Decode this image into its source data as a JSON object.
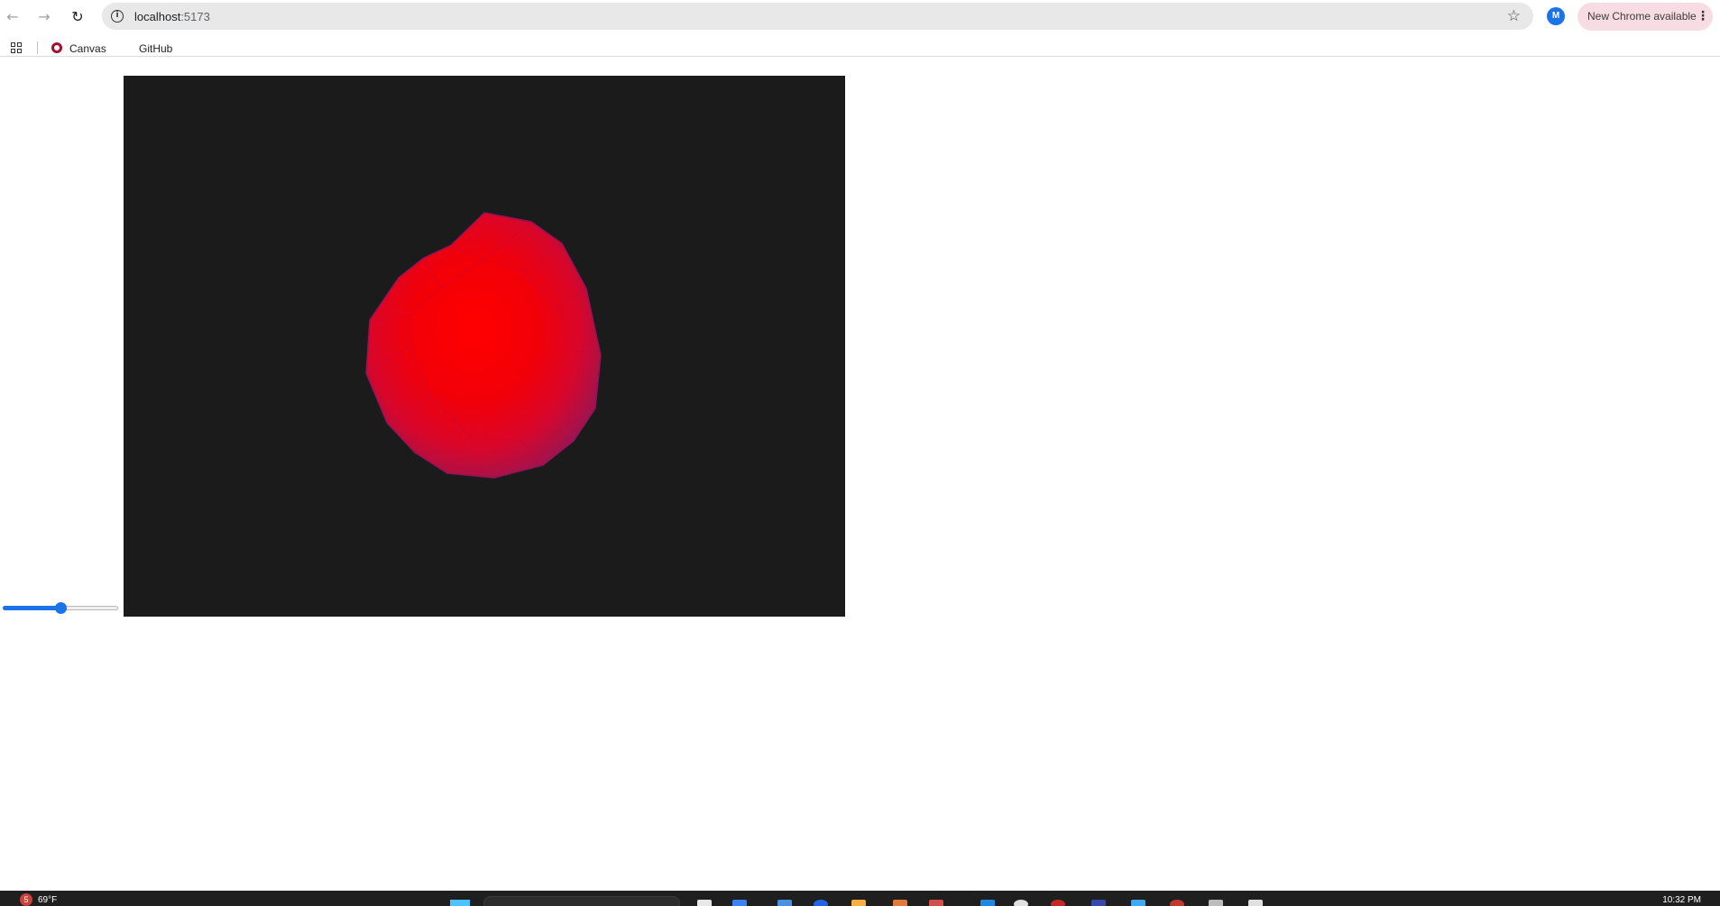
{
  "browser": {
    "url_host": "localhost",
    "url_port": ":5173",
    "profile_initial": "M",
    "update_label": "New Chrome available"
  },
  "bookmarks": [
    {
      "label": "Canvas",
      "icon": "canvas-logo-icon"
    },
    {
      "label": "GitHub",
      "icon": null
    }
  ],
  "page": {
    "slider_value_percent": 50,
    "viewport_background": "#1b1b1b",
    "sphere_color": "#ff0000",
    "sphere_edge_color": "#b0104a"
  },
  "taskbar": {
    "weather_badge": "5",
    "weather_temp": "69°F",
    "clock": "10:32 PM"
  }
}
